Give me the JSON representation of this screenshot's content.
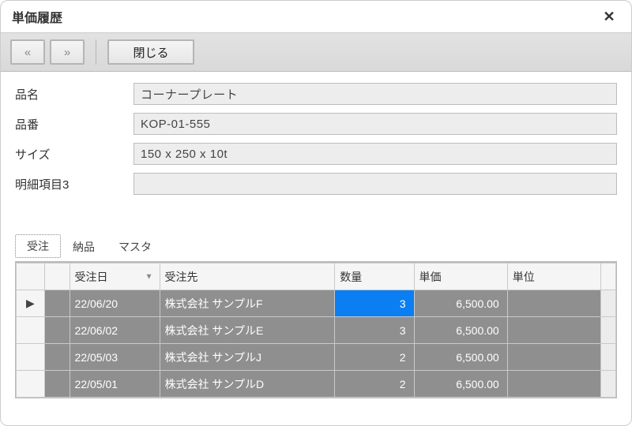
{
  "window": {
    "title": "単価履歴",
    "close_glyph": "✕"
  },
  "toolbar": {
    "prev_glyph": "«",
    "next_glyph": "»",
    "close_label": "閉じる"
  },
  "form": {
    "name_label": "品名",
    "name_value": "コーナープレート",
    "code_label": "品番",
    "code_value": "KOP-01-555",
    "size_label": "サイズ",
    "size_value": "150 x 250 x 10t",
    "detail3_label": "明細項目3",
    "detail3_value": ""
  },
  "tabs": {
    "order": "受注",
    "delivery": "納品",
    "master": "マスタ",
    "active": "order"
  },
  "grid": {
    "headers": {
      "date": "受注日",
      "client": "受注先",
      "qty": "数量",
      "price": "単価",
      "unit": "単位"
    },
    "sort_glyph": "▼",
    "row_marker": "▶",
    "rows": [
      {
        "date": "22/06/20",
        "client": "株式会社 サンプルF",
        "qty": "3",
        "price": "6,500.00",
        "unit": "",
        "selected": true
      },
      {
        "date": "22/06/02",
        "client": "株式会社 サンプルE",
        "qty": "3",
        "price": "6,500.00",
        "unit": "",
        "selected": false
      },
      {
        "date": "22/05/03",
        "client": "株式会社 サンプルJ",
        "qty": "2",
        "price": "6,500.00",
        "unit": "",
        "selected": false
      },
      {
        "date": "22/05/01",
        "client": "株式会社 サンプルD",
        "qty": "2",
        "price": "6,500.00",
        "unit": "",
        "selected": false
      }
    ]
  }
}
